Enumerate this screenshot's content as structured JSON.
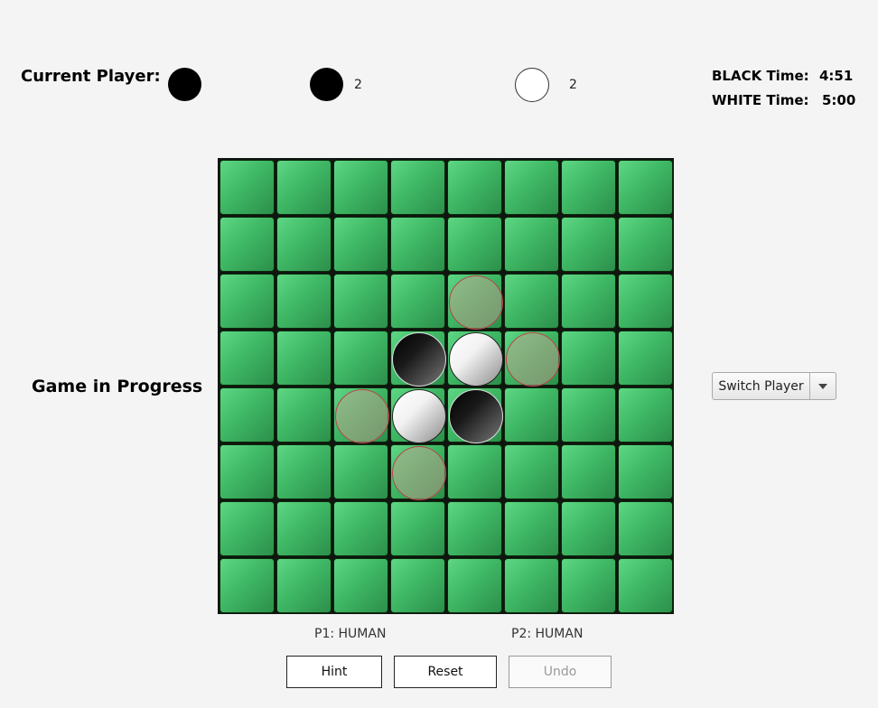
{
  "header": {
    "current_player_label": "Current Player:",
    "current_player": "black",
    "black_count": "2",
    "white_count": "2",
    "black_time_label": "BLACK Time:",
    "black_time": "4:51",
    "white_time_label": "WHITE Time:",
    "white_time": "5:00"
  },
  "status": "Game in Progress",
  "switch_player": {
    "label": "Switch Player"
  },
  "players": {
    "p1": "P1: HUMAN",
    "p2": "P2: HUMAN"
  },
  "buttons": {
    "hint": "Hint",
    "reset": "Reset",
    "undo": "Undo"
  },
  "board": {
    "rows": [
      "........",
      "........",
      "....h...",
      "...BWh..",
      "..hWB...",
      "...h....",
      "........",
      "........"
    ],
    "legend": {
      "B": "black",
      "W": "white",
      "h": "valid-move-hint",
      ".": "empty"
    }
  },
  "colors": {
    "cell": "#3fb865",
    "black": "#000000",
    "white": "#ffffff",
    "hint_border": "#b8454a"
  }
}
